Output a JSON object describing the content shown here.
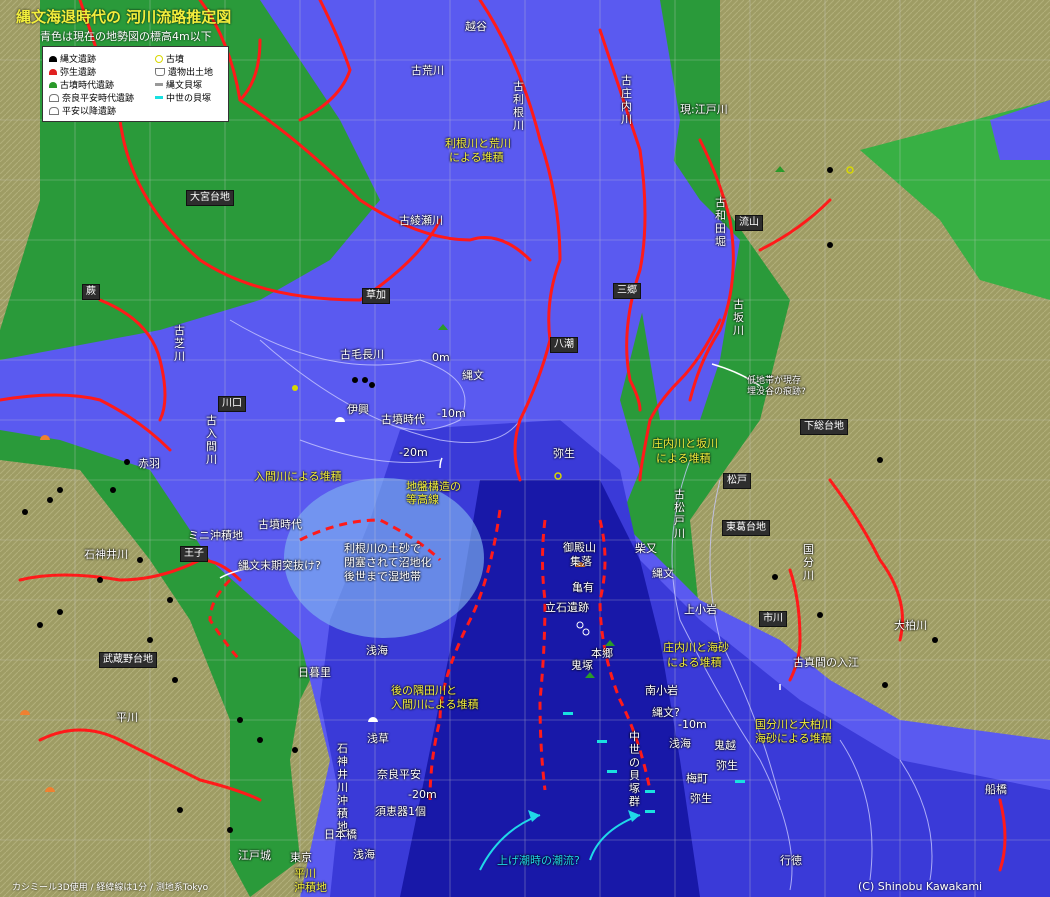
{
  "header": {
    "title": "縄文海退時代の 河川流路推定図",
    "subtitle": "青色は現在の地勢図の標高4m以下"
  },
  "legend": {
    "left": [
      {
        "label": "縄文遺跡",
        "icon": "black-mound-icon",
        "color": "#000000"
      },
      {
        "label": "弥生遺跡",
        "icon": "red-mound-icon",
        "color": "#e02020"
      },
      {
        "label": "古墳時代遺跡",
        "icon": "green-triangle-icon",
        "color": "#2a9a2a"
      },
      {
        "label": "奈良平安時代遺跡",
        "icon": "white-mound-icon",
        "color": "#ffffff"
      },
      {
        "label": "平安以降遺跡",
        "icon": "white-house-icon",
        "color": "#ffffff"
      }
    ],
    "right": [
      {
        "label": "古墳",
        "icon": "yellow-circle-icon",
        "color": "#d8d800"
      },
      {
        "label": "遺物出土地",
        "icon": "cup-icon",
        "color": "#777777"
      },
      {
        "label": "縄文貝塚",
        "icon": "grey-bar-icon",
        "color": "#999999"
      },
      {
        "label": "中世の貝塚",
        "icon": "cyan-bar-icon",
        "color": "#19e0e0"
      }
    ]
  },
  "colors": {
    "plateau": "#9e9c64",
    "lowland_green": "#2a9a3a",
    "shallow_blue": "#5555ee",
    "deep_blue": "#1a1ab0",
    "river_red": "#ff1a1a",
    "label_yellow": "#f2ee3c",
    "grid": "#cccccc"
  },
  "place_boxes": {
    "omiya": "大宮台地",
    "warabi": "蕨",
    "kawaguchi": "川口",
    "soka": "草加",
    "yashio": "八潮",
    "misato": "三郷",
    "nagareyama": "流山",
    "shimosa": "下総台地",
    "matsudo": "松戸",
    "katsushika": "東葛台地",
    "ichikawa": "市川",
    "musashino": "武蔵野台地",
    "oji": "王子"
  },
  "labels": {
    "koshigaya": "越谷",
    "ko_arakawa": "古荒川",
    "gen_edogawa": "現:江戸川",
    "tone_arakawa": "利根川と荒川",
    "tone_arakawa2": "による堆積",
    "akabane": "赤羽",
    "ishigami": "石神井川",
    "hiragawa": "平川",
    "iruma_tai": "入間川による堆積",
    "jiban": "地盤構造の",
    "jiban2": "等高線",
    "mini_okiseki": "ミニ沖積地",
    "kofun1": "古墳時代",
    "kofun2": "古墳時代",
    "jomon_end": "縄文末期突抜け?",
    "tone_tsuchi1": "利根川の土砂で",
    "tone_tsuchi2": "閉塞されて沼地化",
    "tone_tsuchi3": "後世まで湿地帯",
    "yayoi": "弥生",
    "goten": "御殿山",
    "goten2": "集落",
    "shibamata": "柴又",
    "jomon_s": "縄文",
    "kameari": "亀有",
    "tateishi": "立石遺跡",
    "hongo": "本郷",
    "onitsuka": "鬼塚",
    "kamiyasan": "上小岩",
    "shonai_kaisa1": "庄内川と海砂",
    "shonai_kaisa2": "による堆積",
    "shonai_saka1": "庄内川と坂川",
    "shonai_saka2": "による堆積",
    "teichitai1": "低地帯が現存",
    "teichitai2": "埋没谷の痕跡?",
    "kokubun_oshi1": "国分川と大柏川",
    "kokubun_oshi2": "海砂による堆積",
    "komama": "古真間の入江",
    "asakai1": "浅海",
    "asakai2": "浅海",
    "asakai3": "浅海",
    "asakai4": "浅海",
    "sumida1": "後の隅田川と",
    "sumida2": "入間川による堆積",
    "nippori": "日暮里",
    "asakusa": "浅草",
    "nara_heian": "奈良平安",
    "sueki": "須恵器1個",
    "nihonbashi": "日本橋",
    "edojo": "江戸城",
    "tokyo": "東京",
    "minami_koiwa": "南小岩",
    "jomon_q": "縄文?",
    "umemachi": "梅町",
    "yayoi2": "弥生",
    "yayoi3": "弥生",
    "jomon_tamaki": "縄文",
    "ichikawa_hill": "鬼越",
    "funabashi": "船橋",
    "gyotoku": "行徳",
    "agemizu": "上げ潮時の潮流?",
    "m0": "0m",
    "m10a": "-10m",
    "m20a": "-20m",
    "m10b": "-10m",
    "m20b": "-20m",
    "m10c": "-10m",
    "iyo": "伊興",
    "kamoge": "古毛長川",
    "kamoge_kofun": "古墳時代",
    "jomon_ayase": "縄文",
    "ko_ayase": "古綾瀬川",
    "hiragawa_oki": "平川",
    "hiragawa_oki2": "沖積地",
    "chusei_kaizuka": "中世の貝塚群",
    "ishigami_oki": "石神井川",
    "ishigami_oki2": "沖積地"
  },
  "vertical_labels": {
    "ko_tone": "古利根川",
    "ko_shonai": "古庄内川",
    "ko_iruma": "古入間川",
    "ko_shiba": "古芝川",
    "ko_wada": "古和田堀",
    "ko_saka": "古坂川",
    "ko_matsudo": "古松戸川",
    "kokubun": "国分川",
    "oogashiwa": "大柏川",
    "ishigami_okiseki": "石神井川沖積地",
    "chusei": "中世の貝塚群"
  },
  "footer": {
    "left": "カシミール3D使用 / 経緯線は1分 / 測地系Tokyo",
    "right": "(C) Shinobu Kawakami"
  }
}
